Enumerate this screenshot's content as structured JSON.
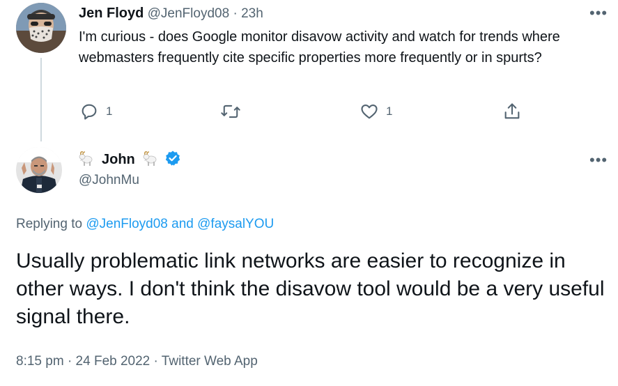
{
  "parent_tweet": {
    "author_name": "Jen Floyd",
    "handle": "@JenFloyd08",
    "separator": "·",
    "time_ago": "23h",
    "text": "I'm curious - does Google monitor disavow activity and watch for trends where webmasters frequently cite specific properties more frequently or in spurts?",
    "actions": {
      "reply_count": "1",
      "retweet_count": "",
      "like_count": "1"
    }
  },
  "main_tweet": {
    "author_name": "John",
    "handle": "@JohnMu",
    "verified": true,
    "name_emoji": "goat",
    "replying_to_prefix": "Replying to",
    "replying_to_1": "@JenFloyd08",
    "replying_to_and": "and",
    "replying_to_2": "@faysalYOU",
    "text": "Usually problematic link networks are easier to recognize in other ways. I don't think the disavow tool would be a very useful signal there.",
    "time": "8:15 pm",
    "dot": "·",
    "date": "24 Feb 2022",
    "source": "Twitter Web App"
  },
  "colors": {
    "text": "#0f1419",
    "muted": "#536471",
    "link": "#1d9bf0",
    "divider": "#cfd9de",
    "verified": "#1d9bf0"
  },
  "icons": [
    "more-icon",
    "reply-icon",
    "retweet-icon",
    "like-icon",
    "share-icon",
    "verified-badge-icon",
    "goat-emoji-icon"
  ]
}
